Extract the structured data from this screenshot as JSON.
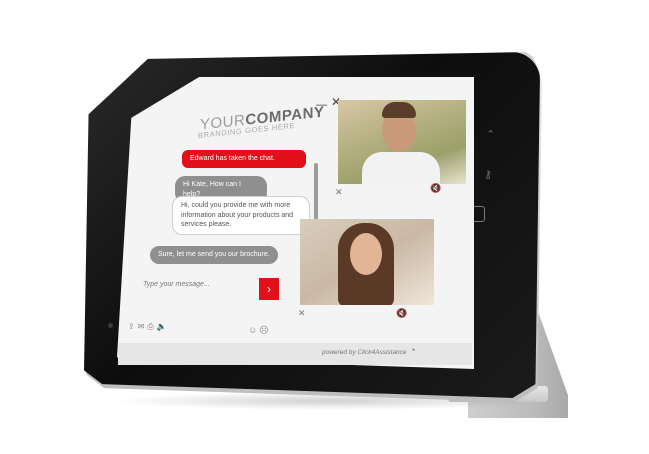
{
  "brand": {
    "name_light": "YOUR",
    "name_bold": "COMPANY",
    "tagline": "BRANDING GOES HERE"
  },
  "window": {
    "minimize_icon": "—",
    "close_icon": "✕"
  },
  "chat": {
    "messages": [
      {
        "text": "Edward has taken the chat.",
        "style": "system",
        "color": "#e3101b"
      },
      {
        "text": "Hi Kate, How can I help?",
        "style": "agent"
      },
      {
        "text": "Hi, could you provide me with more information about your products and services please.",
        "style": "user"
      },
      {
        "text": "Sure, let me send you our brochure.",
        "style": "agent"
      }
    ],
    "input_placeholder": "Type your message...",
    "send_icon": "›",
    "toolbar_icons": [
      "upload-icon",
      "email-icon",
      "print-icon",
      "sound-icon"
    ],
    "toolbar_glyphs": "⇪✉⎙🔈",
    "emoji_glyphs": "☺☹"
  },
  "video": {
    "agent": {
      "close_icon": "✕",
      "mute_icon": "🔇"
    },
    "customer": {
      "close_icon": "✕",
      "mute_icon": "🔇"
    }
  },
  "footer": {
    "powered_by": "powered by Click4Assistance",
    "logo_icon": "speech-bubble-icon",
    "logo_glyph": "◔"
  },
  "colors": {
    "accent": "#e3101b",
    "agent_bubble": "#8f8f8f"
  }
}
